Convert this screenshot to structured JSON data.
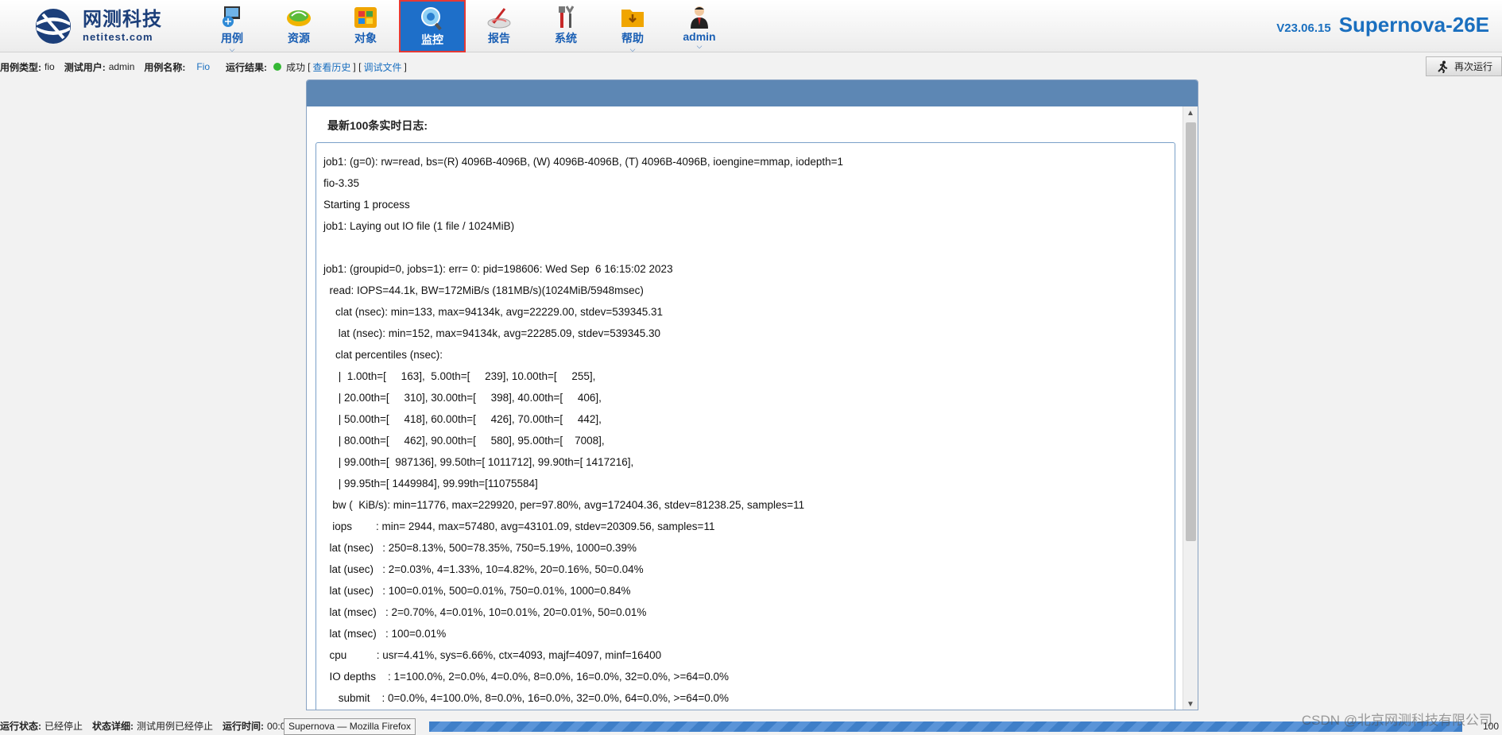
{
  "brand": {
    "name_cn": "网测科技",
    "name_en": "netitest.com"
  },
  "nav": [
    {
      "label": "用例",
      "icon": "use-case-icon",
      "chevron": true,
      "active": false
    },
    {
      "label": "资源",
      "icon": "resource-icon",
      "chevron": false,
      "active": false
    },
    {
      "label": "对象",
      "icon": "object-icon",
      "chevron": false,
      "active": false
    },
    {
      "label": "监控",
      "icon": "monitor-icon",
      "chevron": false,
      "active": true
    },
    {
      "label": "报告",
      "icon": "report-icon",
      "chevron": false,
      "active": false
    },
    {
      "label": "系统",
      "icon": "system-tools-icon",
      "chevron": false,
      "active": false
    },
    {
      "label": "帮助",
      "icon": "help-folder-icon",
      "chevron": true,
      "active": false
    },
    {
      "label": "admin",
      "icon": "admin-user-icon",
      "chevron": true,
      "active": false
    }
  ],
  "version": {
    "number": "V23.06.15",
    "product": "Supernova-26E"
  },
  "info": {
    "case_type_label": "用例类型:",
    "case_type": "fio",
    "user_label": "测试用户:",
    "user": "admin",
    "case_name_label": "用例名称:",
    "case_name": "Fio",
    "result_label": "运行结果:",
    "result": "成功",
    "bracket_open": "[",
    "history_link": "查看历史",
    "bracket_mid": "] [",
    "debug_link": "调试文件",
    "bracket_close": "]"
  },
  "rerun_label": "再次运行",
  "panel": {
    "title": "最新100条实时日志:"
  },
  "log_lines": [
    "job1: (g=0): rw=read, bs=(R) 4096B-4096B, (W) 4096B-4096B, (T) 4096B-4096B, ioengine=mmap, iodepth=1",
    "fio-3.35",
    "Starting 1 process",
    "job1: Laying out IO file (1 file / 1024MiB)",
    "",
    "job1: (groupid=0, jobs=1): err= 0: pid=198606: Wed Sep  6 16:15:02 2023",
    "  read: IOPS=44.1k, BW=172MiB/s (181MB/s)(1024MiB/5948msec)",
    "    clat (nsec): min=133, max=94134k, avg=22229.00, stdev=539345.31",
    "     lat (nsec): min=152, max=94134k, avg=22285.09, stdev=539345.30",
    "    clat percentiles (nsec):",
    "     |  1.00th=[     163],  5.00th=[     239], 10.00th=[     255],",
    "     | 20.00th=[     310], 30.00th=[     398], 40.00th=[     406],",
    "     | 50.00th=[     418], 60.00th=[     426], 70.00th=[     442],",
    "     | 80.00th=[     462], 90.00th=[     580], 95.00th=[    7008],",
    "     | 99.00th=[  987136], 99.50th=[ 1011712], 99.90th=[ 1417216],",
    "     | 99.95th=[ 1449984], 99.99th=[11075584]",
    "   bw (  KiB/s): min=11776, max=229920, per=97.80%, avg=172404.36, stdev=81238.25, samples=11",
    "   iops        : min= 2944, max=57480, avg=43101.09, stdev=20309.56, samples=11",
    "  lat (nsec)   : 250=8.13%, 500=78.35%, 750=5.19%, 1000=0.39%",
    "  lat (usec)   : 2=0.03%, 4=1.33%, 10=4.82%, 20=0.16%, 50=0.04%",
    "  lat (usec)   : 100=0.01%, 500=0.01%, 750=0.01%, 1000=0.84%",
    "  lat (msec)   : 2=0.70%, 4=0.01%, 10=0.01%, 20=0.01%, 50=0.01%",
    "  lat (msec)   : 100=0.01%",
    "  cpu          : usr=4.41%, sys=6.66%, ctx=4093, majf=4097, minf=16400",
    "  IO depths    : 1=100.0%, 2=0.0%, 4=0.0%, 8=0.0%, 16=0.0%, 32=0.0%, >=64=0.0%",
    "     submit    : 0=0.0%, 4=100.0%, 8=0.0%, 16=0.0%, 32=0.0%, 64=0.0%, >=64=0.0%"
  ],
  "status": {
    "state_label": "运行状态:",
    "state": "已经停止",
    "detail_label": "状态详细:",
    "detail": "测试用例已经停止",
    "time_label": "运行时间:",
    "time": "00:0",
    "progress_percent": 100,
    "progress_text": "100"
  },
  "tooltip": "Supernova — Mozilla Firefox",
  "watermark": "CSDN @北京网测科技有限公司",
  "colors": {
    "accent": "#1a6fbf",
    "panel_header": "#5d87b4",
    "active_tab_border": "#e53935",
    "success_dot": "#35b835"
  }
}
